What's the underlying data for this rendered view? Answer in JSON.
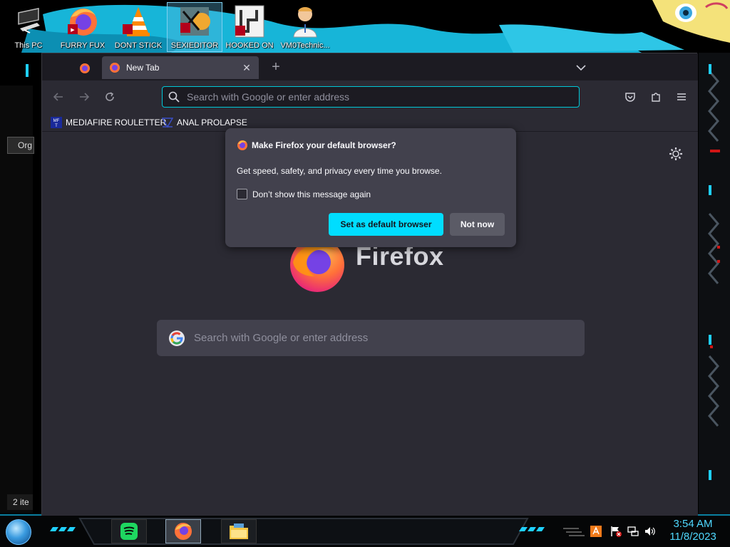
{
  "desktop": {
    "icons": [
      {
        "label": "This PC",
        "icon": "this-pc-icon"
      },
      {
        "label": "FURRY FUX",
        "icon": "firefox-shortcut-icon"
      },
      {
        "label": "DONT STICK",
        "icon": "vlc-shortcut-icon"
      },
      {
        "label": "SEXIEDITOR",
        "icon": "editor-shortcut-icon"
      },
      {
        "label": "HOOKED ON",
        "icon": "game-shortcut-icon"
      },
      {
        "label": "VM0Technic...",
        "icon": "doctor-shortcut-icon"
      }
    ],
    "explorer": {
      "organize_label": "Org",
      "status_text": "2 ite"
    }
  },
  "browser": {
    "tabs": {
      "active_title": "New Tab",
      "close_glyph": "✕",
      "new_tab_glyph": "+"
    },
    "url_placeholder": "Search with Google or enter address",
    "bookmarks": [
      {
        "label": "MEDIAFIRE ROULETTER",
        "icon": "mediafire-icon"
      },
      {
        "label": "ANAL PROLAPSE",
        "icon": "bookmark-favicon-icon"
      }
    ],
    "new_tab_page": {
      "brand": "Firefox",
      "search_placeholder": "Search with Google or enter address"
    },
    "default_prompt": {
      "title": "Make Firefox your default browser?",
      "body": "Get speed, safety, and privacy every time you browse.",
      "checkbox_label": "Don’t show this message again",
      "checkbox_checked": false,
      "primary_button": "Set as default browser",
      "secondary_button": "Not now"
    }
  },
  "taskbar": {
    "pinned": [
      "spotify-icon",
      "firefox-icon",
      "file-explorer-icon"
    ],
    "tray": [
      "avast-icon",
      "action-center-flag-icon",
      "network-icon",
      "volume-icon"
    ],
    "time": "3:54 AM",
    "date": "11/8/2023"
  },
  "colors": {
    "accent": "#00ddff",
    "url_focus": "#00c8d7",
    "toolbar": "#2b2a33",
    "tabbar": "#1c1b22",
    "clock": "#4fd8ff"
  }
}
